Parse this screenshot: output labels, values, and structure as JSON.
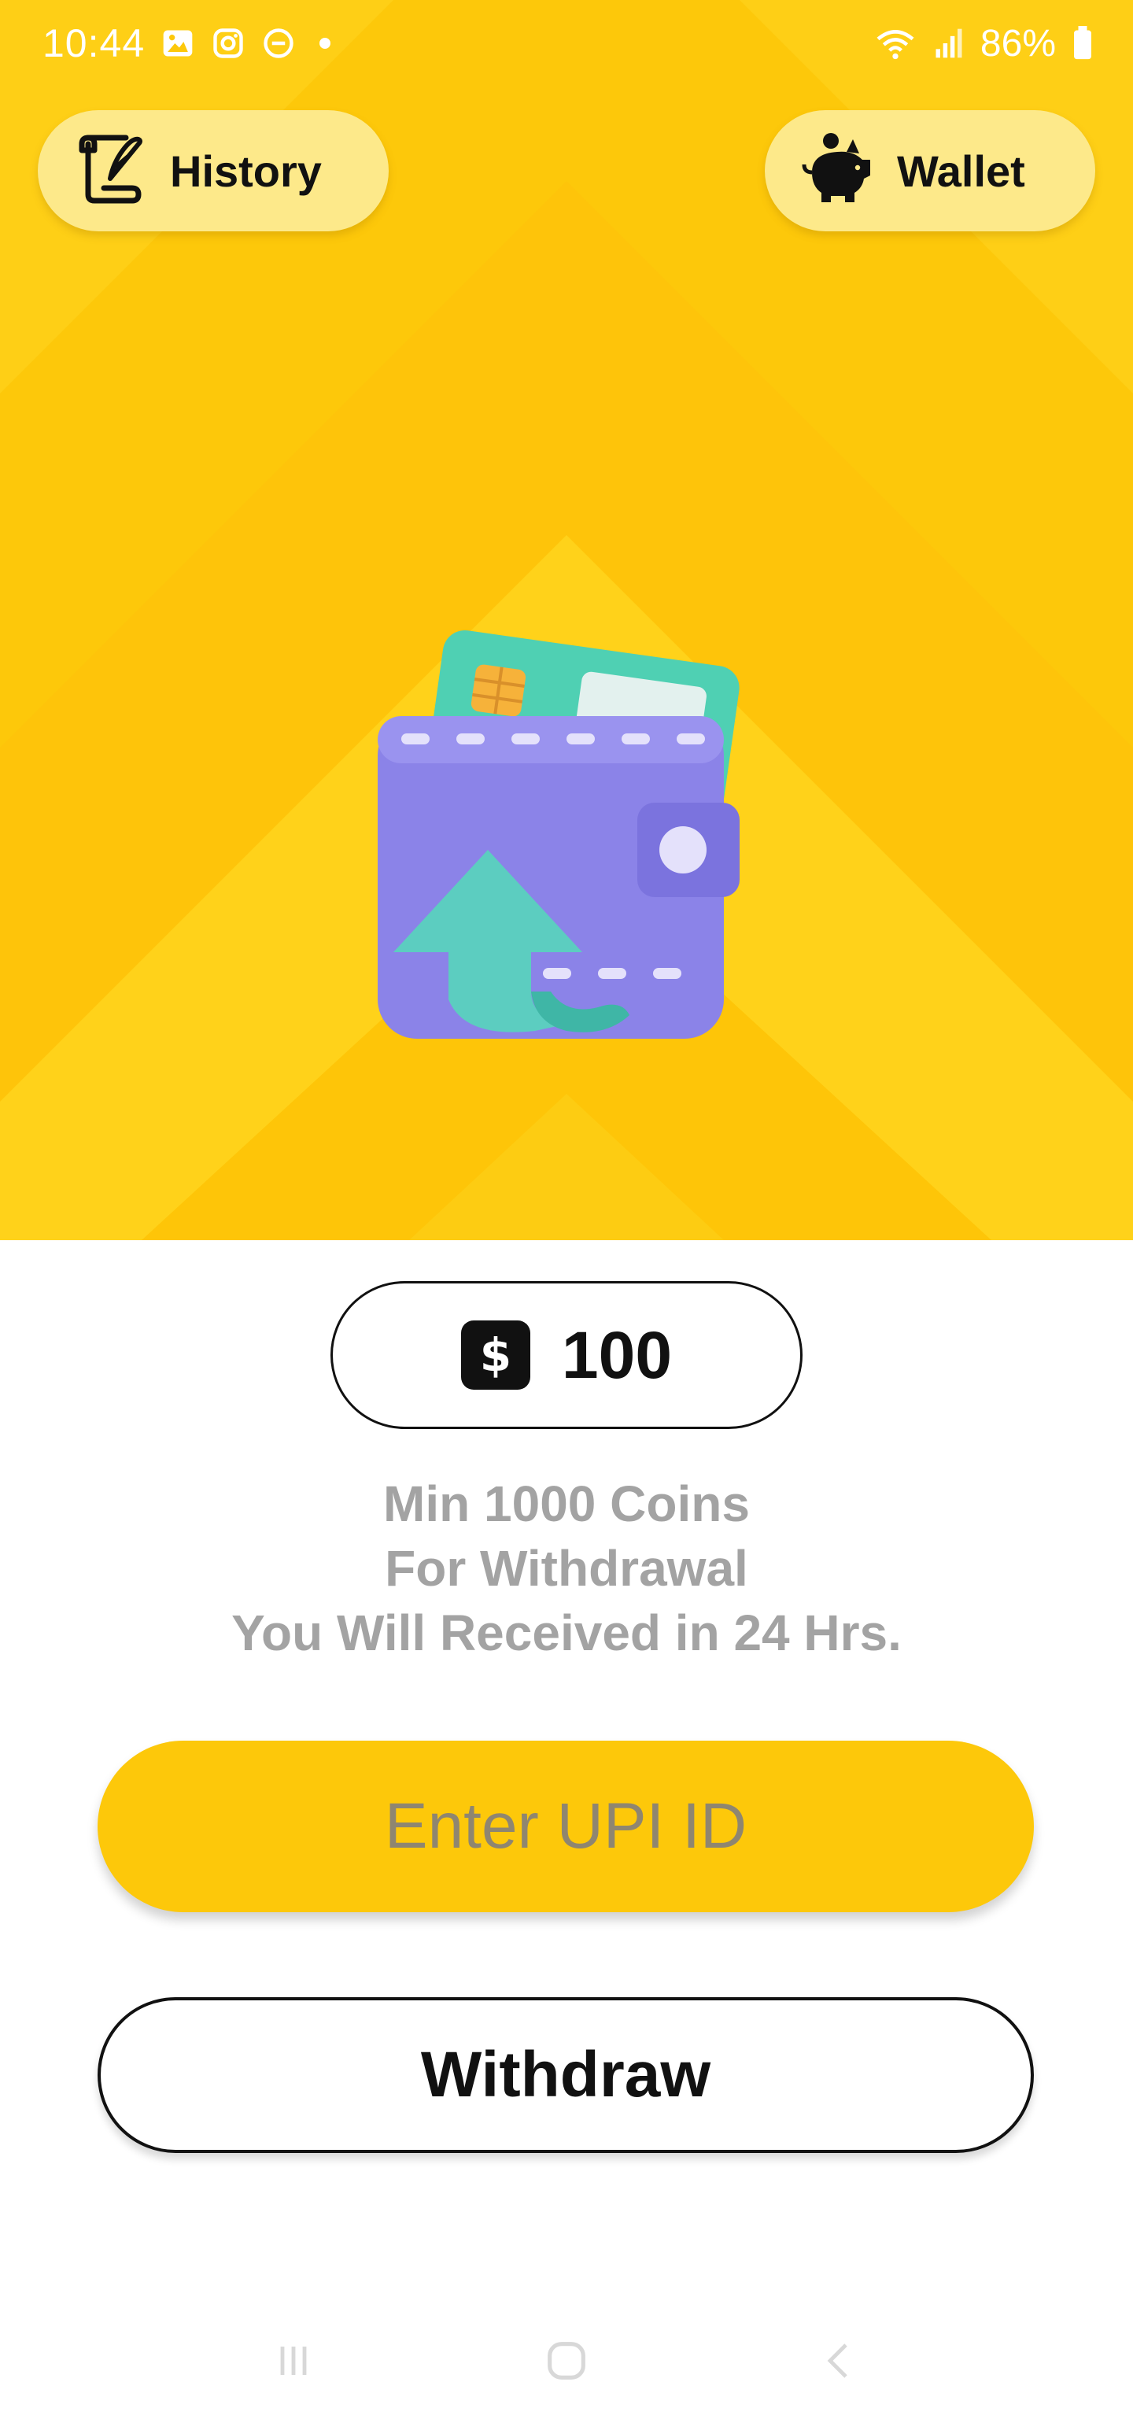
{
  "status_bar": {
    "time": "10:44",
    "battery_percent": "86%",
    "icons": [
      "gallery-icon",
      "instagram-icon",
      "dnd-icon",
      "dot-icon",
      "wifi-icon",
      "signal-icon",
      "battery-icon"
    ]
  },
  "header": {
    "history_label": "History",
    "wallet_label": "Wallet"
  },
  "balance": {
    "currency_symbol": "$",
    "value": "100"
  },
  "info": {
    "line1": "Min 1000 Coins",
    "line2": "For Withdrawal",
    "line3": "You Will Received in 24 Hrs."
  },
  "upi": {
    "placeholder": "Enter UPI ID",
    "value": ""
  },
  "withdraw_label": "Withdraw",
  "colors": {
    "primary_yellow": "#fdc80a",
    "pill_yellow": "#fde98a",
    "text_dark": "#111111",
    "text_muted": "#a3a3a3"
  }
}
